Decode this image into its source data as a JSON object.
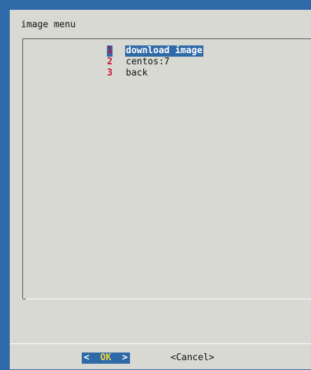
{
  "dialog": {
    "title": "image menu"
  },
  "menu": {
    "items": [
      {
        "key": "1",
        "label": "download image",
        "selected": true
      },
      {
        "key": "2",
        "label": "centos:7",
        "selected": false
      },
      {
        "key": "3",
        "label": "back",
        "selected": false
      }
    ]
  },
  "buttons": {
    "ok": {
      "left": "<",
      "label": "OK",
      "right": ">"
    },
    "cancel": {
      "label": "<Cancel>"
    }
  },
  "colors": {
    "screen_background": "#2f6aa8",
    "dialog_background": "#d9d9d3",
    "selection_background": "#2f6aa8",
    "hotkey": "#c8102e",
    "button_label_active": "#f3d23b"
  }
}
